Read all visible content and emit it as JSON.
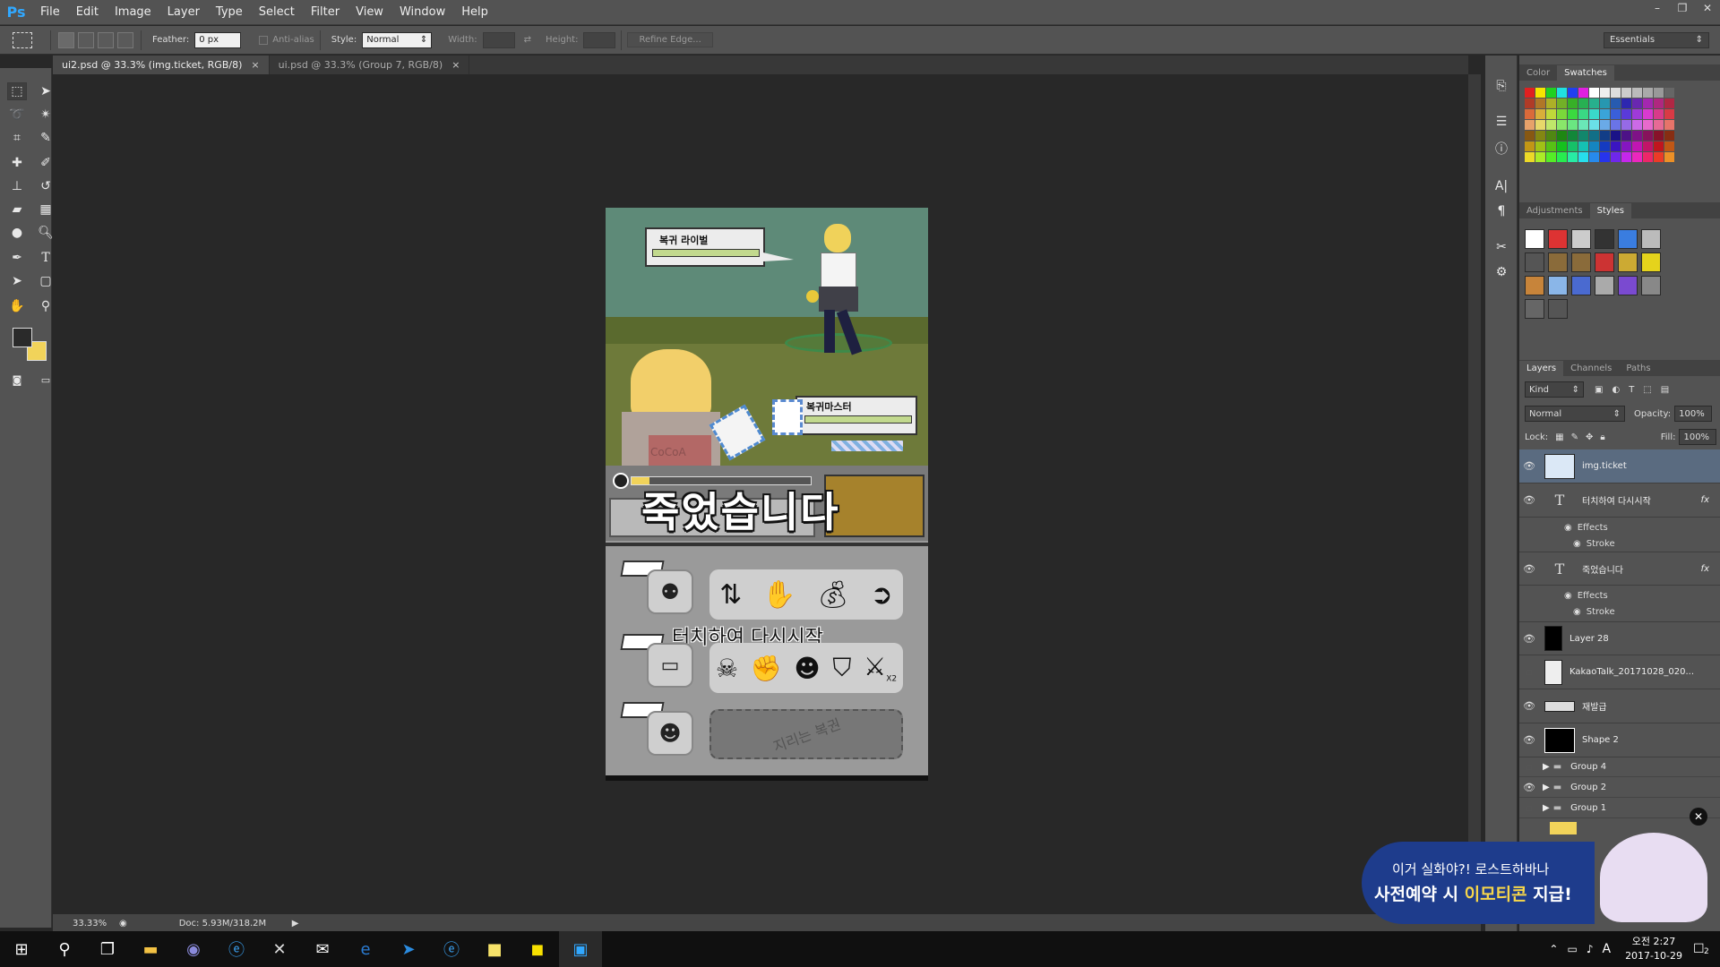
{
  "app": {
    "logo": "Ps"
  },
  "menu": [
    "File",
    "Edit",
    "Image",
    "Layer",
    "Type",
    "Select",
    "Filter",
    "View",
    "Window",
    "Help"
  ],
  "window_controls": [
    "–",
    "❐",
    "✕"
  ],
  "options": {
    "feather_label": "Feather:",
    "feather_value": "0 px",
    "antialias_label": "Anti-alias",
    "style_label": "Style:",
    "style_value": "Normal",
    "width_label": "Width:",
    "height_label": "Height:",
    "refine_edge": "Refine Edge...",
    "workspace": "Essentials"
  },
  "tabs": [
    {
      "label": "ui2.psd @ 33.3% (img.ticket, RGB/8)",
      "close": "×"
    },
    {
      "label": "ui.psd @ 33.3% (Group 7, RGB/8)",
      "close": "×"
    }
  ],
  "game": {
    "rival_label": "복귀 라이벌",
    "master_label": "복귀마스터",
    "watermark": "CoCoA",
    "dead_text": "죽었습니다",
    "restart_text": "터치하여 다시시작",
    "multiplier": "X2",
    "stamp_text": "지리는 복권"
  },
  "status": {
    "zoom": "33.33%",
    "doc": "Doc: 5.93M/318.2M"
  },
  "panels": {
    "color_tabs": [
      "Color",
      "Swatches"
    ],
    "adjust_tabs": [
      "Adjustments",
      "Styles"
    ],
    "layers_tabs": [
      "Layers",
      "Channels",
      "Paths"
    ],
    "kind": "Kind",
    "blend_mode": "Normal",
    "opacity_label": "Opacity:",
    "opacity": "100%",
    "lock_label": "Lock:",
    "fill_label": "Fill:",
    "fill": "100%"
  },
  "layers": [
    {
      "name": "img.ticket",
      "selected": true
    },
    {
      "name": "터치하여 다시시작",
      "fx": "fx"
    },
    {
      "name": "Effects",
      "sub": true
    },
    {
      "name": "Stroke",
      "sub": true
    },
    {
      "name": "죽었습니다",
      "fx": "fx"
    },
    {
      "name": "Effects",
      "sub": true
    },
    {
      "name": "Stroke",
      "sub": true
    },
    {
      "name": "Layer 28"
    },
    {
      "name": "KakaoTalk_20171028_020..."
    },
    {
      "name": "재발급"
    },
    {
      "name": "Shape 2"
    },
    {
      "name": "Group 4"
    },
    {
      "name": "Group 2"
    },
    {
      "name": "Group 1"
    }
  ],
  "ad": {
    "line1": "이거 실화야?! 로스트하바나",
    "line2a": "사전예약 시 ",
    "line2b": "이모티콘",
    "line2c": " 지급!",
    "close": "✕"
  },
  "taskbar": {
    "time": "오전 2:27",
    "date": "2017-10-29",
    "ime": "A",
    "notifications": "2"
  },
  "colors": {
    "accent_yellow": "#f1d35a",
    "selection": "#5a6b80",
    "ad_blue": "#1e3c8c"
  }
}
